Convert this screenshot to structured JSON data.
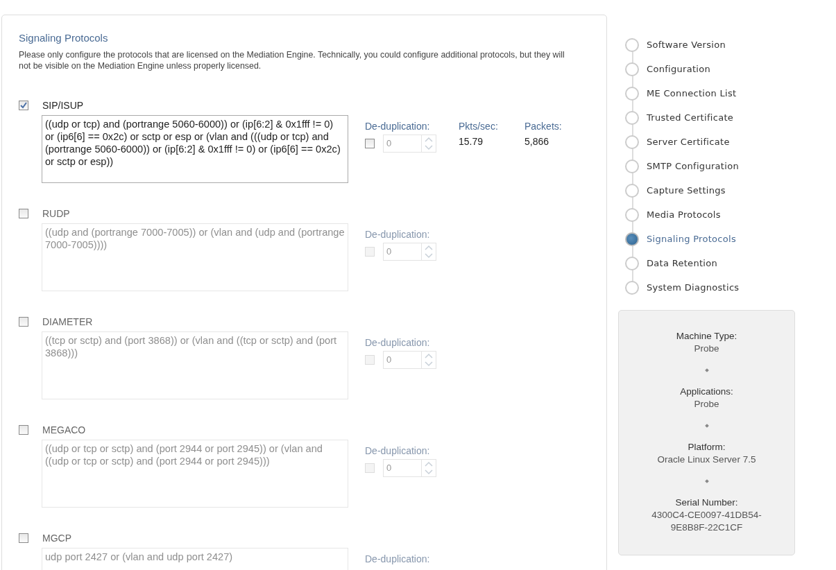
{
  "section": {
    "title": "Signaling Protocols",
    "description": "Please only configure the protocols that are licensed on the Mediation Engine. Technically, you could configure additional protocols, but they will not be visible on the Mediation Engine unless properly licensed."
  },
  "protocols": [
    {
      "name": "SIP/ISUP",
      "checked": true,
      "filter": "((udp or tcp) and (portrange 5060-6000)) or (ip[6:2] & 0x1fff != 0) or (ip6[6] == 0x2c) or sctp or esp or (vlan and (((udp or tcp) and (portrange 5060-6000)) or (ip[6:2] & 0x1fff != 0) or (ip6[6] == 0x2c) or sctp or esp))",
      "dedup_label": "De-duplication:",
      "dedup_checked": false,
      "dedup_value": "0",
      "stats": [
        {
          "label": "Pkts/sec:",
          "value": "15.79"
        },
        {
          "label": "Packets:",
          "value": "5,866"
        }
      ]
    },
    {
      "name": "RUDP",
      "checked": false,
      "filter": "((udp and (portrange 7000-7005)) or (vlan and (udp and (portrange 7000-7005))))",
      "dedup_label": "De-duplication:",
      "dedup_checked": false,
      "dedup_value": "0"
    },
    {
      "name": "DIAMETER",
      "checked": false,
      "filter": "((tcp or sctp) and (port 3868)) or (vlan and ((tcp or sctp) and (port 3868)))",
      "dedup_label": "De-duplication:",
      "dedup_checked": false,
      "dedup_value": "0"
    },
    {
      "name": "MEGACO",
      "checked": false,
      "filter": "((udp or tcp or sctp) and (port 2944 or port 2945)) or (vlan and ((udp or tcp or sctp) and (port 2944 or port 2945)))",
      "dedup_label": "De-duplication:",
      "dedup_checked": false,
      "dedup_value": "0"
    },
    {
      "name": "MGCP",
      "checked": false,
      "filter": "udp port 2427 or (vlan and udp port 2427)",
      "dedup_label": "De-duplication:"
    }
  ],
  "steps": [
    {
      "label": "Software Version",
      "selected": false
    },
    {
      "label": "Configuration",
      "selected": false
    },
    {
      "label": "ME Connection List",
      "selected": false
    },
    {
      "label": "Trusted Certificate",
      "selected": false
    },
    {
      "label": "Server Certificate",
      "selected": false
    },
    {
      "label": "SMTP Configuration",
      "selected": false
    },
    {
      "label": "Capture Settings",
      "selected": false
    },
    {
      "label": "Media Protocols",
      "selected": false
    },
    {
      "label": "Signaling Protocols",
      "selected": true
    },
    {
      "label": "Data Retention",
      "selected": false
    },
    {
      "label": "System Diagnostics",
      "selected": false
    }
  ],
  "info": [
    {
      "label": "Machine Type:",
      "value": "Probe"
    },
    {
      "label": "Applications:",
      "value": "Probe"
    },
    {
      "label": "Platform:",
      "value": "Oracle Linux Server 7.5"
    },
    {
      "label": "Serial Number:",
      "value": "4300C4-CE0097-41DB54-9E8B8F-22C1CF"
    }
  ]
}
